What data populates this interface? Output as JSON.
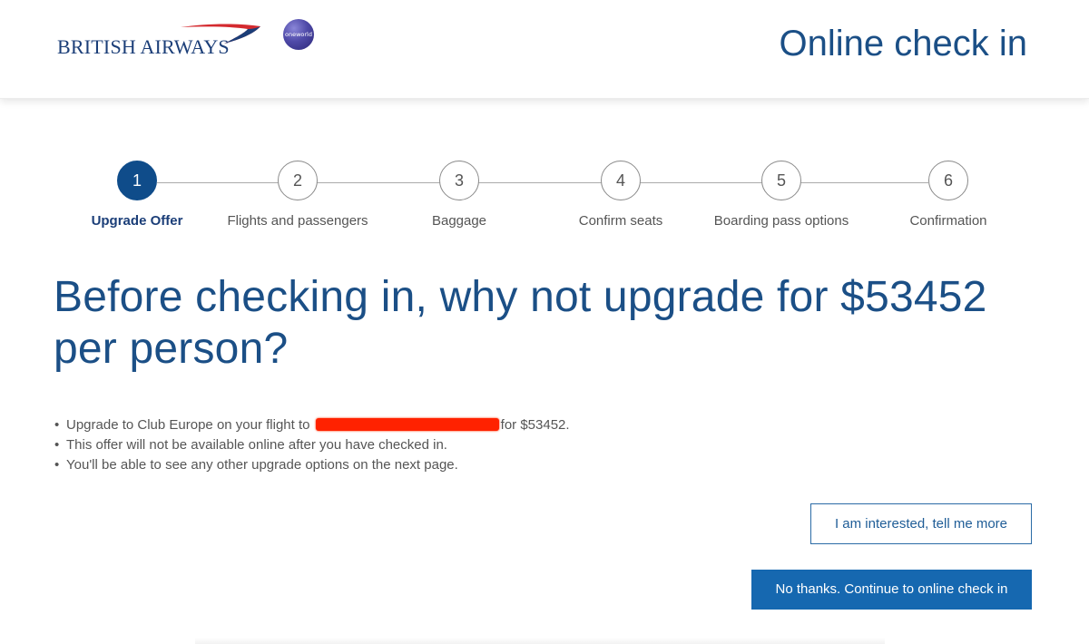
{
  "header": {
    "brand": "BRITISH AIRWAYS",
    "alliance_badge": "oneworld",
    "title": "Online check in"
  },
  "steps": [
    {
      "number": "1",
      "label": "Upgrade Offer",
      "active": true
    },
    {
      "number": "2",
      "label": "Flights and passengers",
      "active": false
    },
    {
      "number": "3",
      "label": "Baggage",
      "active": false
    },
    {
      "number": "4",
      "label": "Confirm seats",
      "active": false
    },
    {
      "number": "5",
      "label": "Boarding pass options",
      "active": false
    },
    {
      "number": "6",
      "label": "Confirmation",
      "active": false
    }
  ],
  "headline": "Before checking in, why not upgrade for $53452 per person?",
  "bullets": {
    "upgrade_prefix": "Upgrade to Club Europe on your flight to",
    "upgrade_suffix": "for $53452.",
    "not_available": "This offer will not be available online after you have checked in.",
    "other_options": "You'll be able to see any other upgrade options on the next page."
  },
  "buttons": {
    "interested": "I am interested, tell me more",
    "continue": "No thanks. Continue to online check in"
  },
  "colors": {
    "brand_blue": "#1b4f86",
    "active_step": "#0f4c8a",
    "primary_button": "#1668b0",
    "redaction": "#ff2200"
  },
  "icons": {
    "brand_mark": "speedmarque-icon",
    "alliance": "oneworld-logo-icon"
  }
}
